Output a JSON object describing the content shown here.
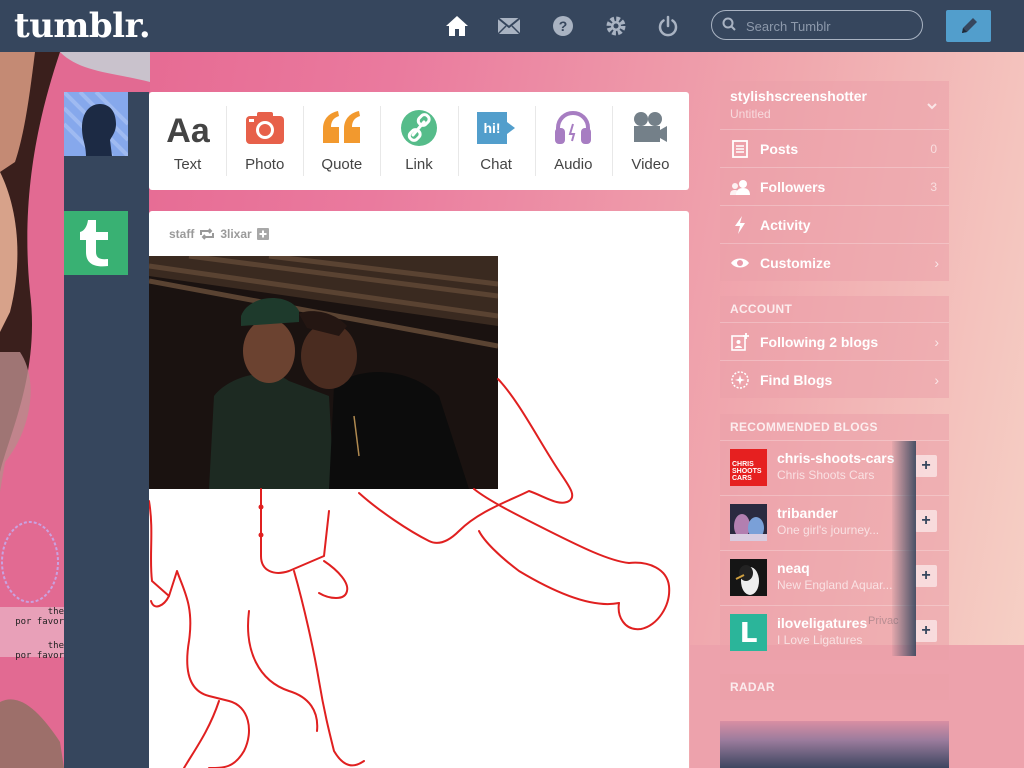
{
  "header": {
    "logo": "tumblr.",
    "nav_icons": [
      "home-icon",
      "mail-icon",
      "help-icon",
      "settings-icon",
      "power-icon"
    ],
    "search_placeholder": "Search Tumblr",
    "compose_icon": "pencil-icon"
  },
  "colors": {
    "navy": "#36465d",
    "blue": "#529ecc",
    "text_red": "#e04b3a",
    "quote_orange": "#f2992e",
    "link_green": "#56bc8a",
    "chat_blue": "#529ecc",
    "audio_purple": "#a77dc2",
    "video_gray": "#748089",
    "drawing_red": "#e02020"
  },
  "post_types": [
    {
      "label": "Text",
      "icon": "text-aa-icon"
    },
    {
      "label": "Photo",
      "icon": "camera-icon"
    },
    {
      "label": "Quote",
      "icon": "quote-icon"
    },
    {
      "label": "Link",
      "icon": "link-icon"
    },
    {
      "label": "Chat",
      "icon": "chat-bubble-icon",
      "glyph": "hi!"
    },
    {
      "label": "Audio",
      "icon": "headphones-icon"
    },
    {
      "label": "Video",
      "icon": "video-camera-icon"
    }
  ],
  "post": {
    "author": "staff",
    "reblogged_from": "3lixar",
    "reblog_icon": "reblog-icon",
    "follow_icon": "plus-square-icon"
  },
  "sidebar": {
    "blog": {
      "name": "stylishscreenshotter",
      "subtitle": "Untitled",
      "rows": [
        {
          "label": "Posts",
          "count": "0",
          "icon": "document-icon"
        },
        {
          "label": "Followers",
          "count": "3",
          "icon": "users-icon"
        },
        {
          "label": "Activity",
          "icon": "lightning-icon"
        },
        {
          "label": "Customize",
          "icon": "eye-icon"
        }
      ]
    },
    "account": {
      "title": "ACCOUNT",
      "rows": [
        {
          "label": "Following 2 blogs",
          "icon": "add-blog-icon"
        },
        {
          "label": "Find Blogs",
          "icon": "compass-icon"
        }
      ]
    },
    "recommended": {
      "title": "RECOMMENDED BLOGS",
      "blogs": [
        {
          "name": "chris-shoots-cars",
          "desc": "Chris Shoots Cars",
          "avatar_text": "CHRIS SHOOTS CARS"
        },
        {
          "name": "tribander",
          "desc": "One girl's journey..."
        },
        {
          "name": "neaq",
          "desc": "New England Aquar..."
        },
        {
          "name": "iloveligatures",
          "desc": "I Love Ligatures",
          "overlap_text": "Privac",
          "avatar_text": "L"
        }
      ]
    },
    "radar": {
      "title": "RADAR"
    }
  },
  "background_text": [
    "the",
    "por favor",
    "the",
    "por favor"
  ]
}
